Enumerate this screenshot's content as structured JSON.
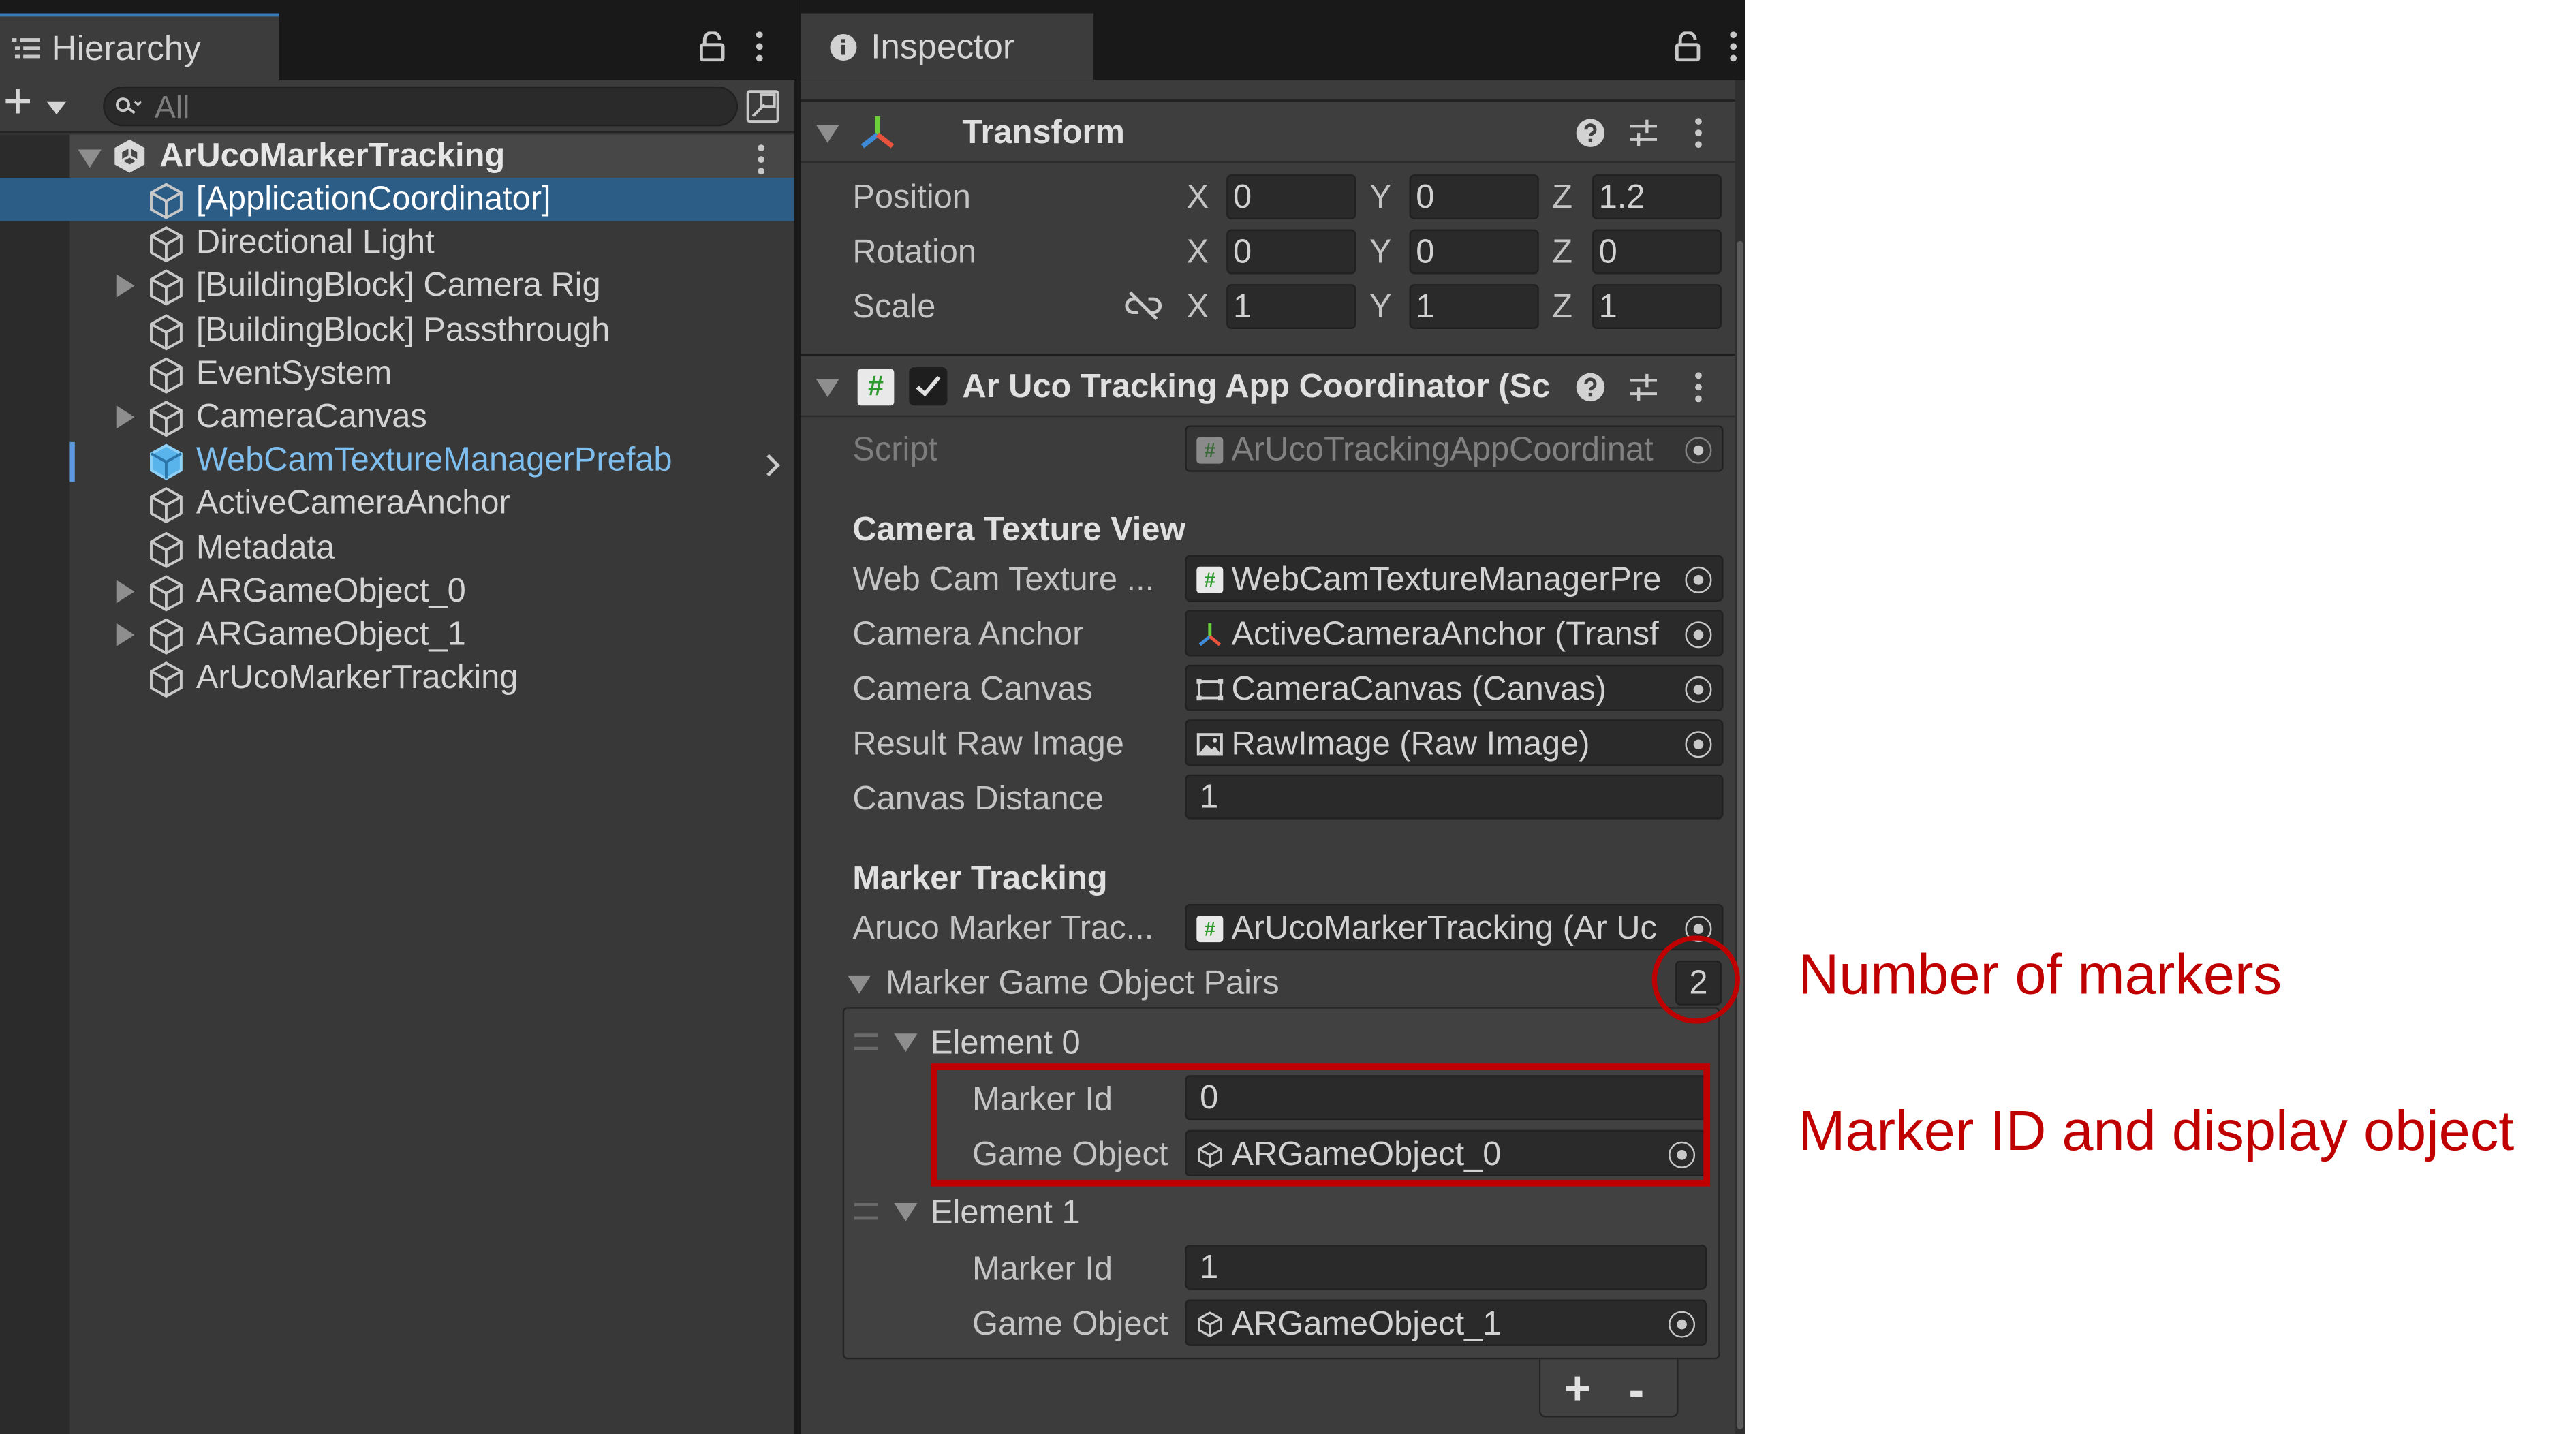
{
  "hierarchy": {
    "tab_label": "Hierarchy",
    "search_placeholder": "All",
    "root": "ArUcoMarkerTracking",
    "items": [
      {
        "label": "[ApplicationCoordinator]",
        "selected": true,
        "expandable": false
      },
      {
        "label": "Directional Light",
        "expandable": false
      },
      {
        "label": "[BuildingBlock] Camera Rig",
        "expandable": true
      },
      {
        "label": "[BuildingBlock] Passthrough",
        "expandable": false
      },
      {
        "label": "EventSystem",
        "expandable": false
      },
      {
        "label": "CameraCanvas",
        "expandable": true
      },
      {
        "label": "WebCamTextureManagerPrefab",
        "prefab": true,
        "expandable": false
      },
      {
        "label": "ActiveCameraAnchor",
        "expandable": false
      },
      {
        "label": "Metadata",
        "expandable": false
      },
      {
        "label": "ARGameObject_0",
        "expandable": true
      },
      {
        "label": "ARGameObject_1",
        "expandable": true
      },
      {
        "label": "ArUcoMarkerTracking",
        "expandable": false
      }
    ]
  },
  "inspector": {
    "tab_label": "Inspector",
    "transform": {
      "title": "Transform",
      "position": {
        "label": "Position",
        "x": "0",
        "y": "0",
        "z": "1.2"
      },
      "rotation": {
        "label": "Rotation",
        "x": "0",
        "y": "0",
        "z": "0"
      },
      "scale": {
        "label": "Scale",
        "x": "1",
        "y": "1",
        "z": "1"
      },
      "axis_x": "X",
      "axis_y": "Y",
      "axis_z": "Z"
    },
    "component": {
      "title": "Ar Uco Tracking App Coordinator (Sc",
      "script_label": "Script",
      "script_value": "ArUcoTrackingAppCoordinat",
      "section_camera": "Camera Texture View",
      "web_cam_label": "Web Cam Texture ...",
      "web_cam_value": "WebCamTextureManagerPre",
      "camera_anchor_label": "Camera Anchor",
      "camera_anchor_value": "ActiveCameraAnchor (Transf",
      "camera_canvas_label": "Camera Canvas",
      "camera_canvas_value": "CameraCanvas (Canvas)",
      "result_raw_label": "Result Raw Image",
      "result_raw_value": "RawImage (Raw Image)",
      "canvas_distance_label": "Canvas Distance",
      "canvas_distance_value": "1",
      "section_marker": "Marker Tracking",
      "aruco_label": "Aruco Marker Trac...",
      "aruco_value": "ArUcoMarkerTracking (Ar Uc",
      "pairs_label": "Marker Game Object Pairs",
      "pairs_count": "2",
      "elements": [
        {
          "label": "Element 0",
          "marker_id_label": "Marker Id",
          "marker_id": "0",
          "game_object_label": "Game Object",
          "game_object": "ARGameObject_0"
        },
        {
          "label": "Element 1",
          "marker_id_label": "Marker Id",
          "marker_id": "1",
          "game_object_label": "Game Object",
          "game_object": "ARGameObject_1"
        }
      ],
      "add_label": "+",
      "remove_label": "-"
    }
  },
  "annotations": {
    "number_of_markers": "Number of markers",
    "marker_id_display": "Marker ID and display object",
    "color": "#c00000"
  }
}
